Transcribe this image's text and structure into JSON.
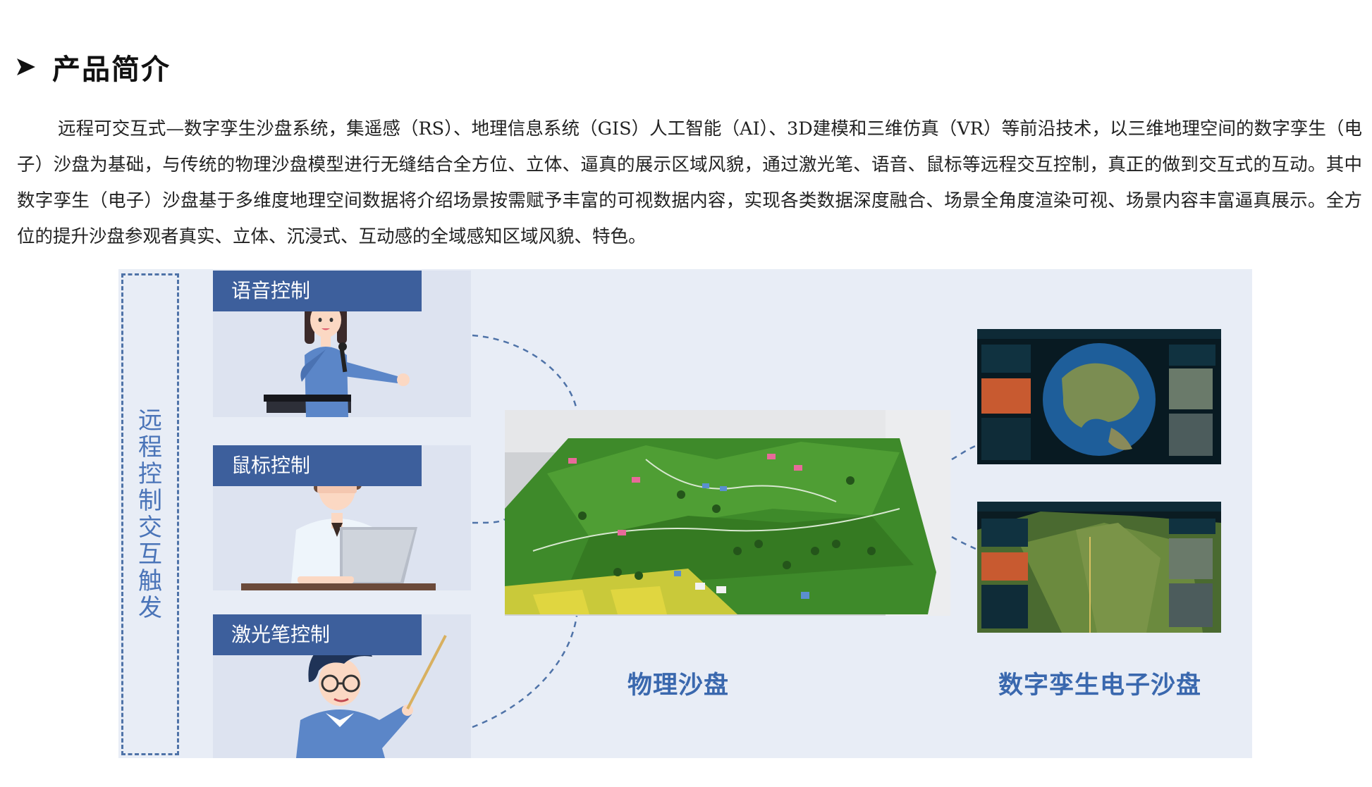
{
  "section": {
    "heading": "产品简介",
    "heading_icon": "arrow-right-icon",
    "intro": "远程可交互式—数字孪生沙盘系统，集遥感（RS）、地理信息系统（GIS）人工智能（AI）、3D建模和三维仿真（VR）等前沿技术，以三维地理空间的数字孪生（电子）沙盘为基础，与传统的物理沙盘模型进行无缝结合全方位、立体、逼真的展示区域风貌，通过激光笔、语音、鼠标等远程交互控制，真正的做到交互式的互动。其中数字孪生（电子）沙盘基于多维度地理空间数据将介绍场景按需赋予丰富的可视数据内容，实现各类数据深度融合、场景全角度渲染可视、场景内容丰富逼真展示。全方位的提升沙盘参观者真实、立体、沉浸式、互动感的全域感知区域风貌、特色。"
  },
  "diagram": {
    "remote_label": "远程控制交互触发",
    "controls": [
      {
        "label": "语音控制",
        "icon": "presenter-with-microphone-icon"
      },
      {
        "label": "鼠标控制",
        "icon": "person-at-laptop-icon"
      },
      {
        "label": "激光笔控制",
        "icon": "person-with-pointer-icon"
      }
    ],
    "physical_caption": "物理沙盘",
    "digital_caption": "数字孪生电子沙盘",
    "colors": {
      "accent": "#3d5f9c",
      "caption": "#3a68ae",
      "figure_bg": "#e8edf6",
      "terrain": "#3e8a2a"
    }
  }
}
